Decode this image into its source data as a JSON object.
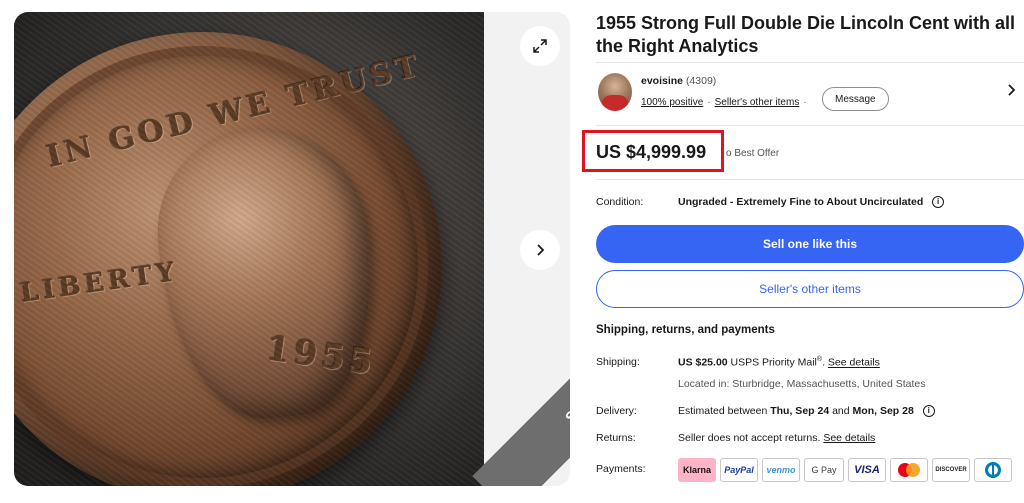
{
  "listing": {
    "title": "1955 Strong Full Double Die Lincoln Cent with all the Right Analytics",
    "sold_ribbon": "SOLD",
    "image_text": {
      "motto": "IN GOD WE TRUST",
      "liberty": "LIBERTY",
      "year": "1955"
    }
  },
  "seller": {
    "name": "evoisine",
    "feedback_count": "(4309)",
    "positive": "100% positive",
    "other_items": "Seller's other items",
    "message_label": "Message"
  },
  "price": {
    "amount": "US $4,999.99",
    "offer_label": "Best Offer",
    "highlight_color": "#e0141e"
  },
  "condition": {
    "label": "Condition:",
    "value": "Ungraded - Extremely Fine to About Uncirculated"
  },
  "actions": {
    "sell_one_like_this": "Sell one like this",
    "sellers_other_items": "Seller's other items",
    "primary_color": "#3665f3"
  },
  "shipping": {
    "heading": "Shipping, returns, and payments",
    "shipping_label": "Shipping:",
    "shipping_price": "US $25.00",
    "shipping_service": "USPS Priority Mail",
    "shipping_details": "See details",
    "location": "Located in: Sturbridge, Massachusetts, United States",
    "delivery_label": "Delivery:",
    "delivery_prefix": "Estimated between",
    "delivery_start": "Thu, Sep 24",
    "delivery_and": "and",
    "delivery_end": "Mon, Sep 28",
    "returns_label": "Returns:",
    "returns_text": "Seller does not accept returns.",
    "returns_details": "See details",
    "payments_label": "Payments:",
    "payment_methods": [
      "Klarna",
      "PayPal",
      "venmo",
      "G Pay",
      "VISA",
      "Mastercard",
      "DISCOVER",
      "Diners Club"
    ]
  },
  "icons": {
    "expand": "expand-icon",
    "next": "chevron-right-icon",
    "seller_chevron": "chevron-right-icon",
    "info": "info-icon"
  }
}
